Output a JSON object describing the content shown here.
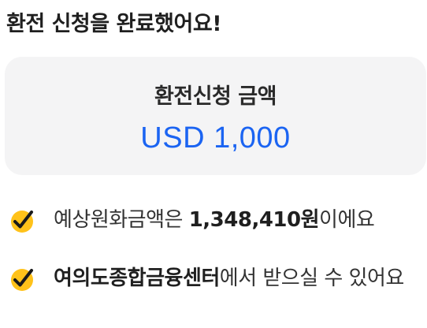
{
  "header": {
    "title": "환전 신청을 완료했어요!"
  },
  "summary": {
    "label": "환전신청 금액",
    "amount": "USD 1,000"
  },
  "info": [
    {
      "icon": "check-icon",
      "prefix": "예상원화금액은 ",
      "highlight": "1,348,410원",
      "suffix": "이에요"
    },
    {
      "icon": "check-icon",
      "prefix": "",
      "highlight": "여의도종합금융센터",
      "suffix": "에서 받으실 수 있어요"
    }
  ],
  "colors": {
    "accent": "#1b64f2",
    "check_fill": "#ffc21a",
    "card_bg": "#f4f4f5"
  }
}
